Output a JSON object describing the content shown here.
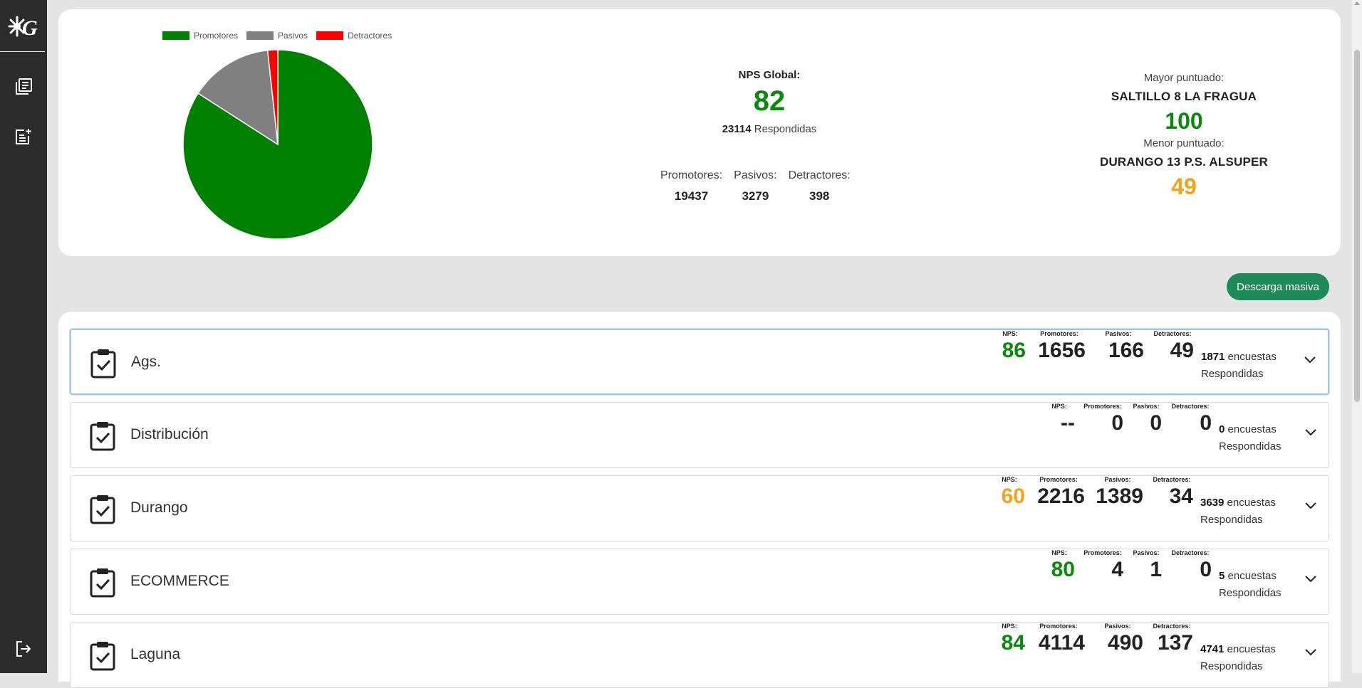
{
  "sidebar": {
    "logo_icon": "company-logo-icon",
    "items": [
      {
        "icon": "document-list-icon"
      },
      {
        "icon": "add-note-icon"
      },
      {
        "icon": "logout-icon"
      }
    ]
  },
  "summary": {
    "legend": [
      {
        "label": "Promotores",
        "color": "#008000"
      },
      {
        "label": "Pasivos",
        "color": "#808080"
      },
      {
        "label": "Detractores",
        "color": "#ff0000"
      }
    ],
    "nps_label": "NPS Global:",
    "nps_value": "82",
    "responded_count": "23114",
    "responded_label": "Respondidas",
    "promotores_label": "Promotores:",
    "pasivos_label": "Pasivos:",
    "detractores_label": "Detractores:",
    "promotores_value": "19437",
    "pasivos_value": "3279",
    "detractores_value": "398",
    "best_label": "Mayor puntuado:",
    "best_name": "SALTILLO 8 LA FRAGUA",
    "best_score": "100",
    "worst_label": "Menor puntuado:",
    "worst_name": "DURANGO 13 P.S. ALSUPER",
    "worst_score": "49"
  },
  "chart_data": {
    "type": "pie",
    "categories": [
      "Promotores",
      "Pasivos",
      "Detractores"
    ],
    "values": [
      19437,
      3279,
      398
    ],
    "colors": [
      "#008000",
      "#808080",
      "#ff0000"
    ],
    "legend": "top"
  },
  "download_label": "Descarga masiva",
  "regions": [
    {
      "name": "Ags.",
      "nps": "86",
      "nps_color": "green",
      "promotores": "1656",
      "pasivos": "166",
      "detractores": "49",
      "encuestas": "1871",
      "selected": true
    },
    {
      "name": "Distribución",
      "nps": "--",
      "nps_color": "dark",
      "promotores": "0",
      "pasivos": "0",
      "detractores": "0",
      "encuestas": "0",
      "selected": false
    },
    {
      "name": "Durango",
      "nps": "60",
      "nps_color": "orange",
      "promotores": "2216",
      "pasivos": "1389",
      "detractores": "34",
      "encuestas": "3639",
      "selected": false
    },
    {
      "name": "ECOMMERCE",
      "nps": "80",
      "nps_color": "green",
      "promotores": "4",
      "pasivos": "1",
      "detractores": "0",
      "encuestas": "5",
      "selected": false
    },
    {
      "name": "Laguna",
      "nps": "84",
      "nps_color": "green",
      "promotores": "4114",
      "pasivos": "490",
      "detractores": "137",
      "encuestas": "4741",
      "selected": false
    }
  ],
  "row_labels": {
    "nps": "NPS:",
    "promotores": "Promotores:",
    "pasivos": "Pasivos:",
    "detractores": "Detractores:",
    "encuestas": "encuestas",
    "respondidas": "Respondidas"
  }
}
